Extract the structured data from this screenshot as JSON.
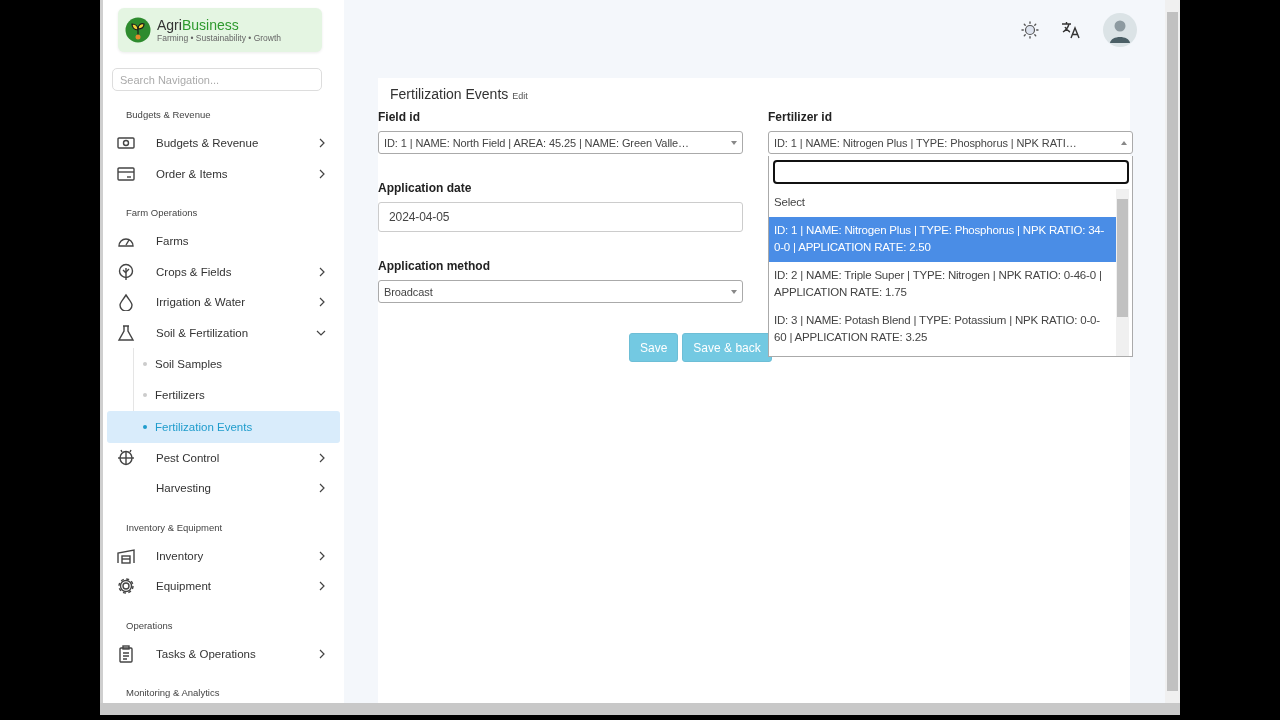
{
  "brand": {
    "name": [
      "Agri",
      "Business"
    ],
    "tagline": "Farming • Sustainability • Growth"
  },
  "sidebar": {
    "search": {
      "placeholder": "Search Navigation..."
    },
    "sections": [
      {
        "heading": "Budgets & Revenue",
        "items": [
          {
            "label": "Budgets & Revenue",
            "expanded": false
          },
          {
            "label": "Order & Items",
            "expanded": false
          }
        ]
      },
      {
        "heading": "Farm Operations",
        "items": [
          {
            "label": "Farms"
          },
          {
            "label": "Crops & Fields",
            "expanded": false
          },
          {
            "label": "Irrigation & Water",
            "expanded": false
          },
          {
            "label": "Soil & Fertilization",
            "expanded": true,
            "children": [
              {
                "label": "Soil Samples",
                "selected": false
              },
              {
                "label": "Fertilizers",
                "selected": false
              },
              {
                "label": "Fertilization Events",
                "selected": true
              }
            ]
          },
          {
            "label": "Pest Control",
            "expanded": false
          },
          {
            "label": "Harvesting",
            "expanded": false
          }
        ]
      },
      {
        "heading": "Inventory & Equipment",
        "items": [
          {
            "label": "Inventory",
            "expanded": false
          },
          {
            "label": "Equipment",
            "expanded": false
          }
        ]
      },
      {
        "heading": "Operations",
        "items": [
          {
            "label": "Tasks & Operations",
            "expanded": false
          }
        ]
      },
      {
        "heading": "Monitoring & Analytics"
      }
    ]
  },
  "form": {
    "title": "Fertilization Events",
    "subtitle": "Edit",
    "left_fields": [
      {
        "kind": "select",
        "label": "Field id",
        "value": "ID: 1 | NAME: North Field | AREA: 45.25 | NAME: Green Valle…"
      },
      {
        "kind": "input",
        "label": "Application date",
        "value": "2024-04-05"
      },
      {
        "kind": "select",
        "label": "Application method",
        "value": "Broadcast"
      }
    ],
    "fertilizer": {
      "label": "Fertilizer id",
      "value": "ID: 1 | NAME: Nitrogen Plus | TYPE: Phosphorus | NPK RATI…",
      "open": true,
      "options": [
        {
          "label": "Select",
          "selected": false
        },
        {
          "label": "ID: 1 | NAME: Nitrogen Plus | TYPE: Phosphorus | NPK RATIO: 34-0-0 | APPLICATION RATE: 2.50",
          "selected": true
        },
        {
          "label": "ID: 2 | NAME: Triple Super | TYPE: Nitrogen | NPK RATIO: 0-46-0 | APPLICATION RATE: 1.75",
          "selected": false
        },
        {
          "label": "ID: 3 | NAME: Potash Blend | TYPE: Potassium | NPK RATIO: 0-0-60 | APPLICATION RATE: 3.25",
          "selected": false
        }
      ]
    },
    "buttons": [
      "Save",
      "Save & back"
    ]
  }
}
